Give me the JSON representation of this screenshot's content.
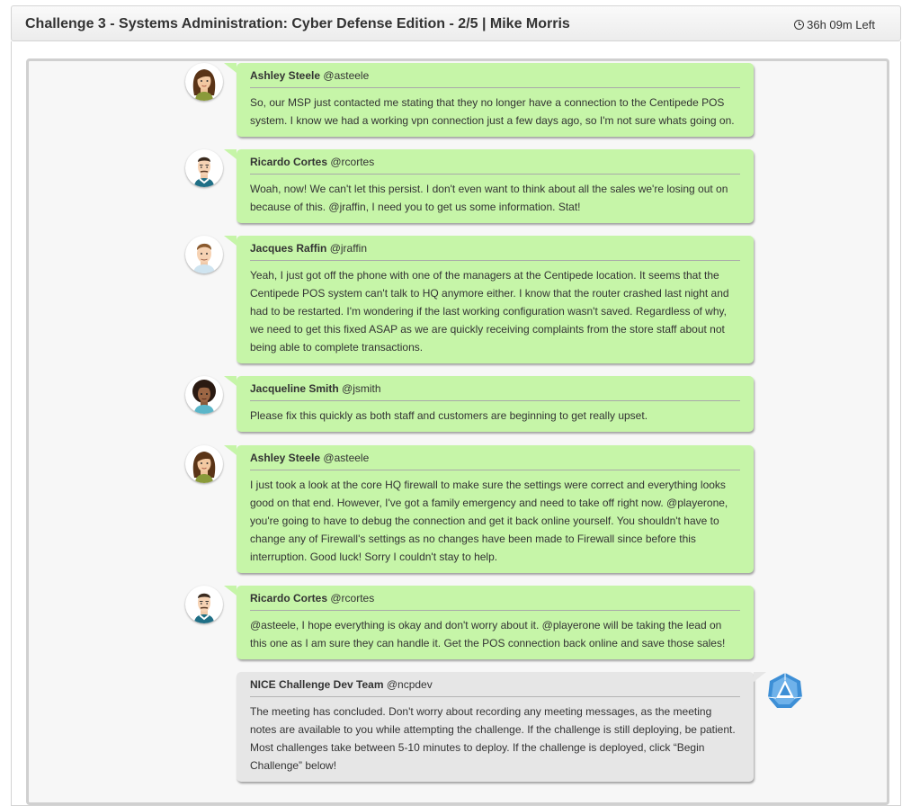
{
  "header": {
    "title": "Challenge 3 - Systems Administration: Cyber Defense Edition - 2/5 | Mike Morris",
    "timer": "36h 09m Left",
    "timer_icon": "clock-icon"
  },
  "messages": [
    {
      "name": "Ashley Steele",
      "handle": "@asteele",
      "avatar": "ashley-avatar",
      "text": "So, our MSP just contacted me stating that they no longer have a connection to the Centipede POS system. I know we had a working vpn connection just a few days ago, so I'm not sure whats going on."
    },
    {
      "name": "Ricardo Cortes",
      "handle": "@rcortes",
      "avatar": "ricardo-avatar",
      "text": "Woah, now! We can't let this persist. I don't even want to think about all the sales we're losing out on because of this. @jraffin, I need you to get us some information. Stat!"
    },
    {
      "name": "Jacques Raffin",
      "handle": "@jraffin",
      "avatar": "jacques-avatar",
      "text": "Yeah, I just got off the phone with one of the managers at the Centipede location. It seems that the Centipede POS system can't talk to HQ anymore either. I know that the router crashed last night and had to be restarted. I'm wondering if the last working configuration wasn't saved. Regardless of why, we need to get this fixed ASAP as we are quickly receiving complaints from the store staff about not being able to complete transactions."
    },
    {
      "name": "Jacqueline Smith",
      "handle": "@jsmith",
      "avatar": "jacqueline-avatar",
      "text": "Please fix this quickly as both staff and customers are beginning to get really upset."
    },
    {
      "name": "Ashley Steele",
      "handle": "@asteele",
      "avatar": "ashley-avatar",
      "text": "I just took a look at the core HQ firewall to make sure the settings were correct and everything looks good on that end. However, I've got a family emergency and need to take off right now. @playerone, you're going to have to debug the connection and get it back online yourself. You shouldn't have to change any of Firewall's settings as no changes have been made to Firewall since before this interruption. Good luck! Sorry I couldn't stay to help."
    },
    {
      "name": "Ricardo Cortes",
      "handle": "@rcortes",
      "avatar": "ricardo-avatar",
      "text": "@asteele, I hope everything is okay and don't worry about it. @playerone will be taking the lead on this one as I am sure they can handle it. Get the POS connection back online and save those sales!"
    },
    {
      "name": "NICE Challenge Dev Team",
      "handle": "@ncpdev",
      "avatar": "nice-logo",
      "text": "The meeting has concluded. Don't worry about recording any meeting messages, as the meeting notes are available to you while attempting the challenge. If the challenge is still deploying, be patient. Most challenges take between 5-10 minutes to deploy. If the challenge is deployed, click “Begin Challenge” below!"
    }
  ],
  "colors": {
    "bubble_green": "#c6f5a8",
    "bubble_grey": "#e6e6e6",
    "nice_blue": "#3d8fd6"
  }
}
